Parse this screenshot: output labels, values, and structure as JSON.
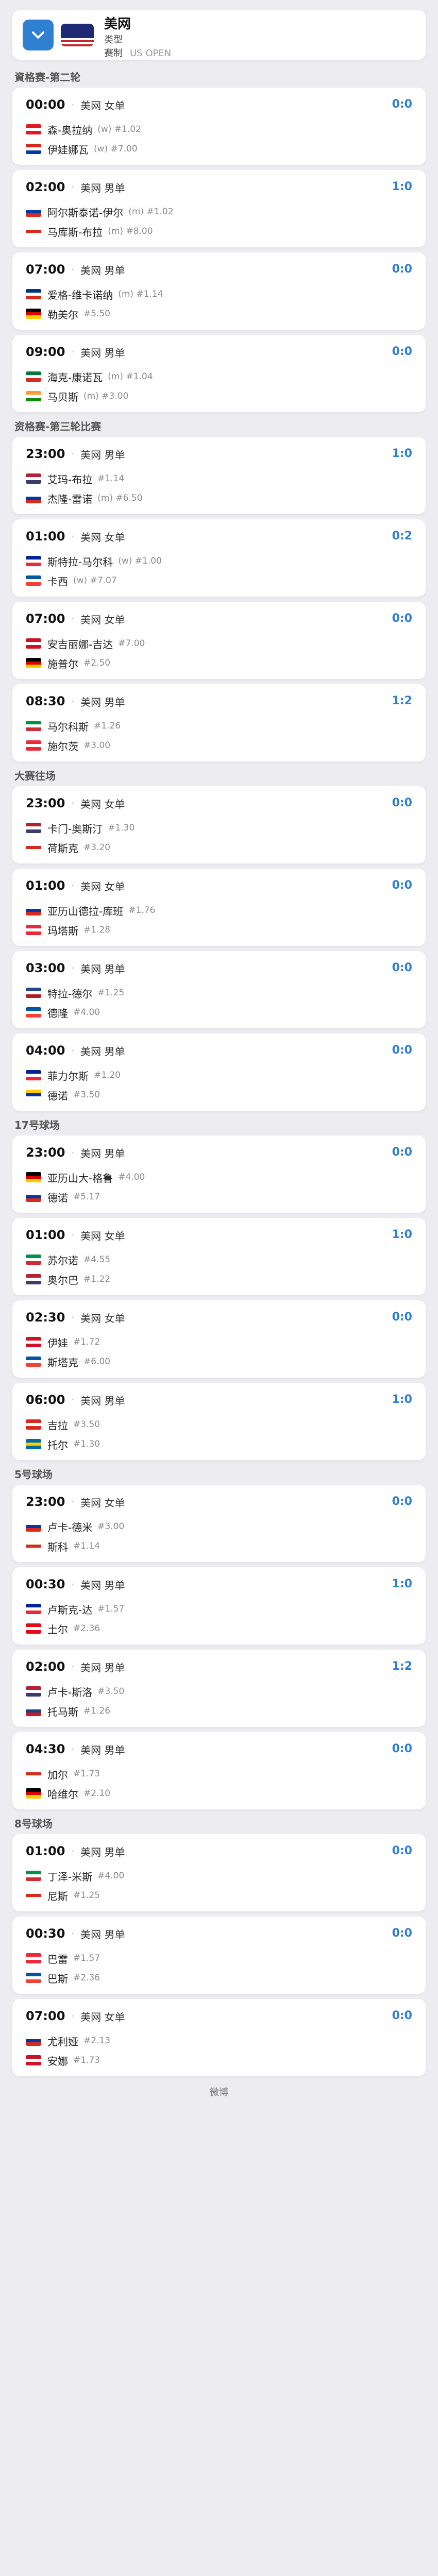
{
  "header": {
    "title": "美网",
    "row1_key": "类型",
    "row1_value": "",
    "row2_key": "赛制",
    "row2_value": "US OPEN"
  },
  "rounds": [
    {
      "title": "資格赛-第二轮",
      "matches": [
        {
          "time": "00:00",
          "league": "美网 女单",
          "score": "0:0",
          "p1": {
            "name": "森-奥拉纳",
            "rank": "(w) #1.02",
            "flag": [
              "#e11b22",
              "#ffffff",
              "#e11b22"
            ]
          },
          "p2": {
            "name": "伊娃娜瓦",
            "rank": "(w) #7.00",
            "flag": [
              "#d52b1e",
              "#ffffff",
              "#0039a6"
            ]
          }
        },
        {
          "time": "02:00",
          "league": "美网 男单",
          "score": "1:0",
          "p1": {
            "name": "阿尔斯泰诺-伊尔",
            "rank": "(m) #1.02",
            "flag": [
              "#ffffff",
              "#0038a8",
              "#d52b1e"
            ]
          },
          "p2": {
            "name": "马库斯-布拉",
            "rank": "(m) #8.00",
            "flag": [
              "#ffffff",
              "#d52b1e",
              "#ffffff"
            ]
          }
        },
        {
          "time": "07:00",
          "league": "美网 男单",
          "score": "0:0",
          "p1": {
            "name": "爱格-维卡诺纳",
            "rank": "(m) #1.14",
            "flag": [
              "#003580",
              "#ffffff",
              "#d52b1e"
            ]
          },
          "p2": {
            "name": "勒美尔",
            "rank": "#5.50",
            "flag": [
              "#000000",
              "#dd0000",
              "#ffce00"
            ]
          }
        },
        {
          "time": "09:00",
          "league": "美网 男单",
          "score": "0:0",
          "p1": {
            "name": "海克-康诺瓦",
            "rank": "(m) #1.04",
            "flag": [
              "#007a3d",
              "#ffffff",
              "#d52b1e"
            ]
          },
          "p2": {
            "name": "马贝斯",
            "rank": "(m) #3.00",
            "flag": [
              "#ff9933",
              "#ffffff",
              "#138808"
            ]
          }
        }
      ]
    },
    {
      "title": "资格赛-第三轮比赛",
      "matches": [
        {
          "time": "23:00",
          "league": "美网 男单",
          "score": "1:0",
          "p1": {
            "name": "艾玛-布拉",
            "rank": "#1.14",
            "flag": [
              "#b22234",
              "#ffffff",
              "#3c3b6e"
            ]
          },
          "p2": {
            "name": "杰隆-雷诺",
            "rank": "(m) #6.50",
            "flag": [
              "#ffffff",
              "#0038a8",
              "#d52b1e"
            ]
          }
        },
        {
          "time": "01:00",
          "league": "美网 女单",
          "score": "0:2",
          "p1": {
            "name": "斯特拉-马尔科",
            "rank": "(w) #1.00",
            "flag": [
              "#002395",
              "#ffffff",
              "#ed2939"
            ]
          },
          "p2": {
            "name": "卡西",
            "rank": "(w) #7.07",
            "flag": [
              "#0055a4",
              "#ffffff",
              "#ef4135"
            ]
          }
        },
        {
          "time": "07:00",
          "league": "美网 女单",
          "score": "0:0",
          "p1": {
            "name": "安吉丽娜-吉达",
            "rank": "#7.00",
            "flag": [
              "#ce1126",
              "#ffffff",
              "#ce1126"
            ]
          },
          "p2": {
            "name": "施普尔",
            "rank": "#2.50",
            "flag": [
              "#000000",
              "#dd0000",
              "#ffce00"
            ]
          }
        },
        {
          "time": "08:30",
          "league": "美网 男单",
          "score": "1:2",
          "p1": {
            "name": "马尔科斯",
            "rank": "#1.26",
            "flag": [
              "#009246",
              "#ffffff",
              "#ce2b37"
            ]
          },
          "p2": {
            "name": "施尔茨",
            "rank": "#3.00",
            "flag": [
              "#ed2939",
              "#ffffff",
              "#ed2939"
            ]
          }
        }
      ]
    },
    {
      "title": "大赛往场",
      "matches": [
        {
          "time": "23:00",
          "league": "美网 女单",
          "score": "0:0",
          "p1": {
            "name": "卡门-奥斯汀",
            "rank": "#1.30",
            "flag": [
              "#b22234",
              "#ffffff",
              "#3c3b6e"
            ]
          },
          "p2": {
            "name": "荷斯克",
            "rank": "#3.20",
            "flag": [
              "#ffffff",
              "#d52b1e",
              "#ffffff"
            ]
          }
        },
        {
          "time": "01:00",
          "league": "美网 女单",
          "score": "0:0",
          "p1": {
            "name": "亚历山德拉-库班",
            "rank": "#1.76",
            "flag": [
              "#ffffff",
              "#0039a6",
              "#d52b1e"
            ]
          },
          "p2": {
            "name": "玛塔斯",
            "rank": "#1.28",
            "flag": [
              "#ed2939",
              "#ffffff",
              "#ed2939"
            ]
          }
        },
        {
          "time": "03:00",
          "league": "美网 男单",
          "score": "0:0",
          "p1": {
            "name": "特拉-德尔",
            "rank": "#1.25",
            "flag": [
              "#21468b",
              "#ffffff",
              "#ae1c28"
            ]
          },
          "p2": {
            "name": "德隆",
            "rank": "#4.00",
            "flag": [
              "#0055a4",
              "#ffffff",
              "#ef4135"
            ]
          }
        },
        {
          "time": "04:00",
          "league": "美网 男单",
          "score": "0:0",
          "p1": {
            "name": "菲力尔斯",
            "rank": "#1.20",
            "flag": [
              "#002395",
              "#ffffff",
              "#ed2939"
            ]
          },
          "p2": {
            "name": "德诺",
            "rank": "#3.50",
            "flag": [
              "#ffcc00",
              "#003399",
              "#ffffff"
            ]
          }
        }
      ]
    },
    {
      "title": "17号球场",
      "matches": [
        {
          "time": "23:00",
          "league": "美网 男单",
          "score": "0:0",
          "p1": {
            "name": "亚历山大-格鲁",
            "rank": "#4.00",
            "flag": [
              "#000000",
              "#dd0000",
              "#ffce00"
            ]
          },
          "p2": {
            "name": "德诺",
            "rank": "#5.17",
            "flag": [
              "#ffffff",
              "#0038a8",
              "#d52b1e"
            ]
          }
        },
        {
          "time": "01:00",
          "league": "美网 女单",
          "score": "1:0",
          "p1": {
            "name": "苏尔诺",
            "rank": "#4.55",
            "flag": [
              "#009246",
              "#ffffff",
              "#ce2b37"
            ]
          },
          "p2": {
            "name": "奥尔巴",
            "rank": "#1.22",
            "flag": [
              "#b22234",
              "#ffffff",
              "#3c3b6e"
            ]
          }
        },
        {
          "time": "02:30",
          "league": "美网 女单",
          "score": "0:0",
          "p1": {
            "name": "伊娃",
            "rank": "#1.72",
            "flag": [
              "#ce1126",
              "#ffffff",
              "#ce1126"
            ]
          },
          "p2": {
            "name": "斯塔克",
            "rank": "#6.00",
            "flag": [
              "#0055a4",
              "#ffffff",
              "#ef4135"
            ]
          }
        },
        {
          "time": "06:00",
          "league": "美网 男单",
          "score": "1:0",
          "p1": {
            "name": "吉拉",
            "rank": "#3.50",
            "flag": [
              "#d52b1e",
              "#ffffff",
              "#d52b1e"
            ]
          },
          "p2": {
            "name": "托尔",
            "rank": "#1.30",
            "flag": [
              "#006aa7",
              "#fecc00",
              "#006aa7"
            ]
          }
        }
      ]
    },
    {
      "title": "5号球场",
      "matches": [
        {
          "time": "23:00",
          "league": "美网 女单",
          "score": "0:0",
          "p1": {
            "name": "卢卡-德米",
            "rank": "#3.00",
            "flag": [
              "#ffffff",
              "#0038a8",
              "#d52b1e"
            ]
          },
          "p2": {
            "name": "斯科",
            "rank": "#1.14",
            "flag": [
              "#ffffff",
              "#d52b1e",
              "#ffffff"
            ]
          }
        },
        {
          "time": "00:30",
          "league": "美网 男单",
          "score": "1:0",
          "p1": {
            "name": "卢斯克-达",
            "rank": "#1.57",
            "flag": [
              "#002395",
              "#ffffff",
              "#ed2939"
            ]
          },
          "p2": {
            "name": "土尔",
            "rank": "#2.36",
            "flag": [
              "#e30a17",
              "#ffffff",
              "#e30a17"
            ]
          }
        },
        {
          "time": "02:00",
          "league": "美网 男单",
          "score": "1:2",
          "p1": {
            "name": "卢卡-斯洛",
            "rank": "#3.50",
            "flag": [
              "#b22234",
              "#ffffff",
              "#3c3b6e"
            ]
          },
          "p2": {
            "name": "托马斯",
            "rank": "#1.26",
            "flag": [
              "#ffffff",
              "#11457e",
              "#d7141a"
            ]
          }
        },
        {
          "time": "04:30",
          "league": "美网 男单",
          "score": "0:0",
          "p1": {
            "name": "加尔",
            "rank": "#1.73",
            "flag": [
              "#ffffff",
              "#d52b1e",
              "#ffffff"
            ]
          },
          "p2": {
            "name": "哈维尔",
            "rank": "#2.10",
            "flag": [
              "#000000",
              "#dd0000",
              "#ffce00"
            ]
          }
        }
      ]
    },
    {
      "title": "8号球场",
      "matches": [
        {
          "time": "01:00",
          "league": "美网 男单",
          "score": "0:0",
          "p1": {
            "name": "丁泽-米斯",
            "rank": "#4.00",
            "flag": [
              "#009246",
              "#ffffff",
              "#ce2b37"
            ]
          },
          "p2": {
            "name": "尼斯",
            "rank": "#1.25",
            "flag": [
              "#ffffff",
              "#d52b1e",
              "#ffffff"
            ]
          }
        },
        {
          "time": "00:30",
          "league": "美网 男单",
          "score": "0:0",
          "p1": {
            "name": "巴雷",
            "rank": "#1.57",
            "flag": [
              "#ed2939",
              "#ffffff",
              "#ed2939"
            ]
          },
          "p2": {
            "name": "巴斯",
            "rank": "#2.36",
            "flag": [
              "#0055a4",
              "#ffffff",
              "#ef4135"
            ]
          }
        },
        {
          "time": "07:00",
          "league": "美网 女单",
          "score": "0:0",
          "p1": {
            "name": "尤利娅",
            "rank": "#2.13",
            "flag": [
              "#ffffff",
              "#0039a6",
              "#d52b1e"
            ]
          },
          "p2": {
            "name": "安娜",
            "rank": "#1.73",
            "flag": [
              "#ce1126",
              "#ffffff",
              "#ce1126"
            ]
          }
        }
      ]
    }
  ],
  "footer": {
    "text": "微博"
  }
}
